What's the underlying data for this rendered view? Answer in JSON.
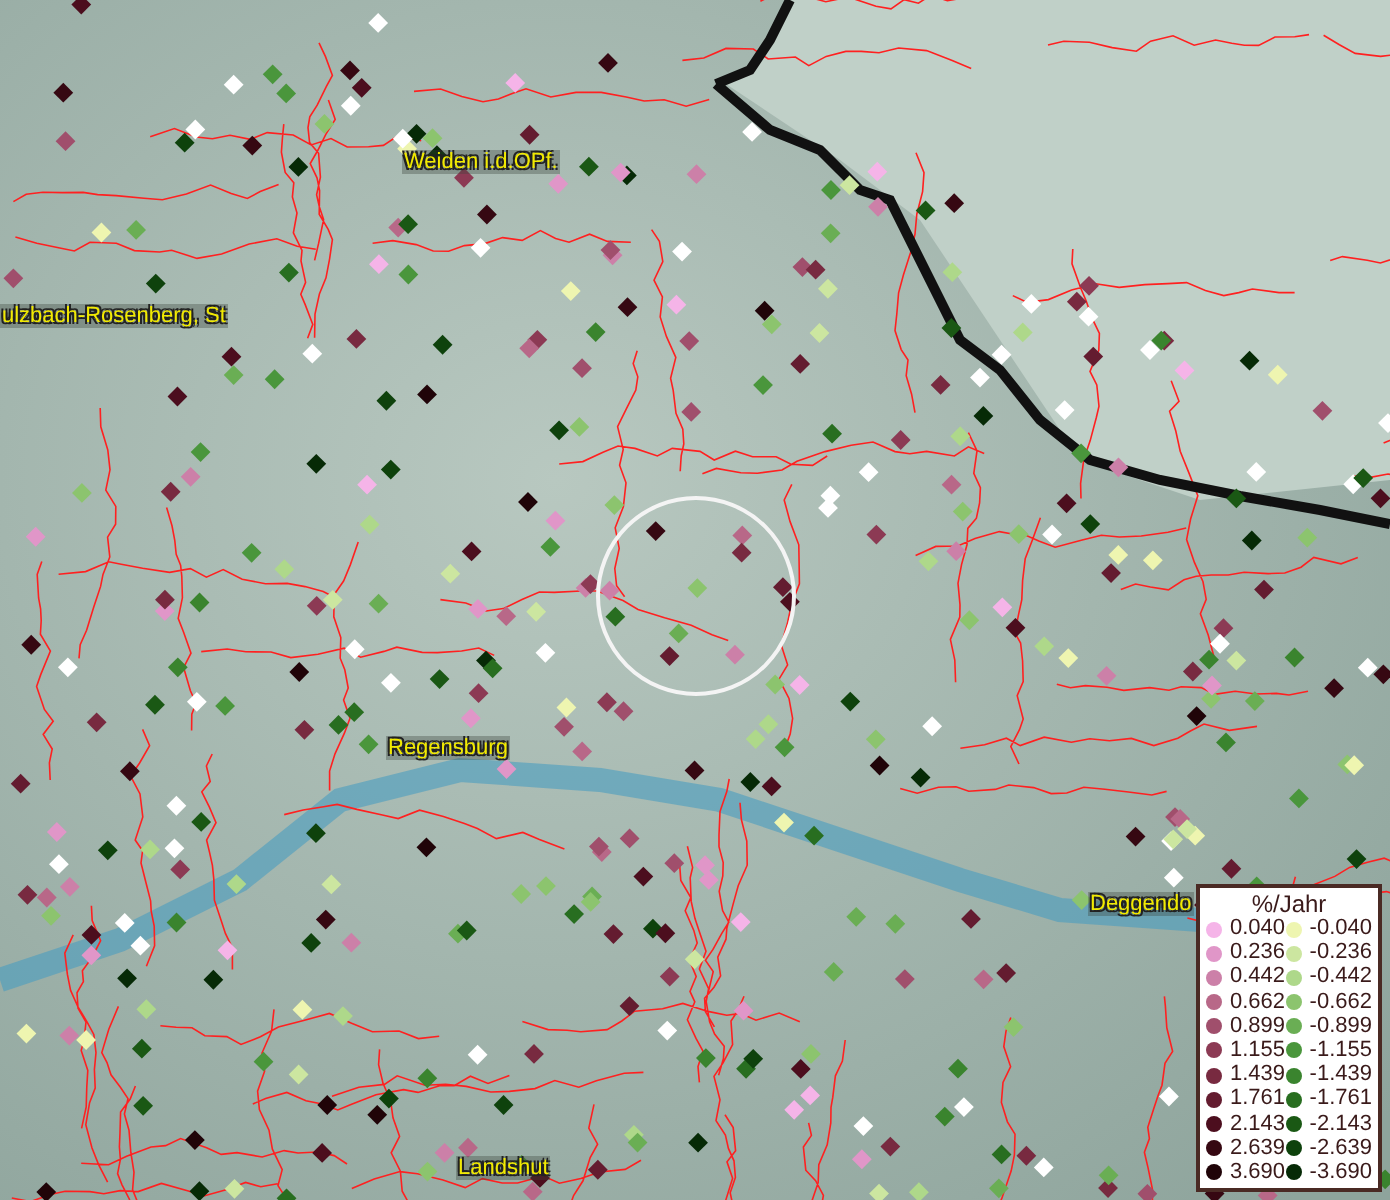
{
  "map": {
    "places": [
      {
        "name": "Weiden i.d.OPf."
      },
      {
        "name": "ulzbach-Rosenberg, St"
      },
      {
        "name": "Regensburg"
      },
      {
        "name": "Deggendo"
      },
      {
        "name": "Landshut"
      }
    ]
  },
  "legend": {
    "title": "%/Jahr",
    "entries": [
      {
        "label": "0.040",
        "color": "#f5b4e8"
      },
      {
        "label": "-0.040",
        "color": "#eef5b0"
      },
      {
        "label": "0.236",
        "color": "#e096c8"
      },
      {
        "label": "-0.236",
        "color": "#cce6a0"
      },
      {
        "label": "0.442",
        "color": "#cc80a8"
      },
      {
        "label": "-0.442",
        "color": "#aed88a"
      },
      {
        "label": "0.662",
        "color": "#b86888"
      },
      {
        "label": "-0.662",
        "color": "#8cc46e"
      },
      {
        "label": "0.899",
        "color": "#a04f6c"
      },
      {
        "label": "-0.899",
        "color": "#6aae54"
      },
      {
        "label": "1.155",
        "color": "#8c3a54"
      },
      {
        "label": "-1.155",
        "color": "#4a963c"
      },
      {
        "label": "1.439",
        "color": "#782a40"
      },
      {
        "label": "-1.439",
        "color": "#3a842e"
      },
      {
        "label": "1.761",
        "color": "#641c30"
      },
      {
        "label": "-1.761",
        "color": "#286e20"
      },
      {
        "label": "2.143",
        "color": "#4c0e1e"
      },
      {
        "label": "-2.143",
        "color": "#1a5814"
      },
      {
        "label": "2.639",
        "color": "#360812"
      },
      {
        "label": "-2.639",
        "color": "#0e420c"
      },
      {
        "label": "3.690",
        "color": "#200408"
      },
      {
        "label": "-3.690",
        "color": "#062a06"
      }
    ]
  }
}
